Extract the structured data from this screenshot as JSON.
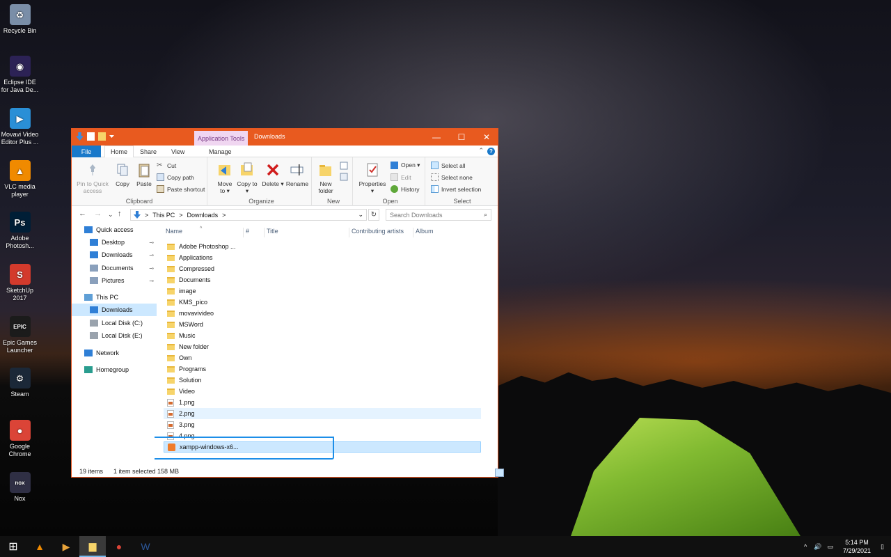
{
  "desktop": {
    "icons": [
      {
        "label": "Recycle Bin",
        "icon": "recycle-bin-icon",
        "color": "#7a8ea8"
      },
      {
        "label": "Eclipse IDE for Java De...",
        "icon": "eclipse-icon",
        "color": "#2c2255"
      },
      {
        "label": "Movavi Video Editor Plus ...",
        "icon": "movavi-icon",
        "color": "#2a8fd6"
      },
      {
        "label": "VLC media player",
        "icon": "vlc-icon",
        "color": "#f08a00"
      },
      {
        "label": "Adobe Photosh...",
        "icon": "photoshop-icon",
        "color": "#001e36"
      },
      {
        "label": "SketchUp 2017",
        "icon": "sketchup-icon",
        "color": "#d33a2c"
      },
      {
        "label": "Epic Games Launcher",
        "icon": "epic-games-icon",
        "color": "#1b1b1b"
      },
      {
        "label": "Steam",
        "icon": "steam-icon",
        "color": "#1b2838"
      },
      {
        "label": "Google Chrome",
        "icon": "chrome-icon",
        "color": "#db4437"
      },
      {
        "label": "Nox",
        "icon": "nox-icon",
        "color": "#2f2f44"
      }
    ],
    "icon_glyphs": [
      "♻",
      "◉",
      "▶",
      "▲",
      "Ps",
      "S",
      "EPIC",
      "⚙",
      "●",
      "nox"
    ]
  },
  "window": {
    "context_tab": "Application Tools",
    "title": "Downloads",
    "controls": {
      "minimize": "—",
      "maximize": "☐",
      "close": "✕"
    },
    "tabs": [
      "File",
      "Home",
      "Share",
      "View",
      "Manage"
    ],
    "help": "?",
    "chevron": "⌃",
    "ribbon": {
      "clipboard": {
        "label": "Clipboard",
        "pin": "Pin to Quick access",
        "copy": "Copy",
        "paste": "Paste",
        "cut": "Cut",
        "copy_path": "Copy path",
        "paste_shortcut": "Paste shortcut"
      },
      "organize": {
        "label": "Organize",
        "move_to": "Move to ▾",
        "copy_to": "Copy to ▾",
        "delete": "Delete ▾",
        "rename": "Rename"
      },
      "new": {
        "label": "New",
        "new_folder": "New folder"
      },
      "open": {
        "label": "Open",
        "properties": "Properties ▾",
        "open": "Open ▾",
        "edit": "Edit",
        "history": "History"
      },
      "select": {
        "label": "Select",
        "select_all": "Select all",
        "select_none": "Select none",
        "invert": "Invert selection"
      }
    },
    "address": {
      "path": [
        "This PC",
        "Downloads"
      ],
      "separator": ">",
      "dropdown": "⌄",
      "refresh": "↻",
      "back": "←",
      "forward": "→",
      "recent": "⌄",
      "up": "↑"
    },
    "search": {
      "placeholder": "Search Downloads",
      "icon": "⌕"
    },
    "nav": [
      {
        "label": "Quick access",
        "icon": "star-icon",
        "indent": 0
      },
      {
        "label": "Desktop",
        "icon": "desktop-icon",
        "indent": 1,
        "pinned": true
      },
      {
        "label": "Downloads",
        "icon": "download-icon",
        "indent": 1,
        "pinned": true
      },
      {
        "label": "Documents",
        "icon": "document-icon",
        "indent": 1,
        "pinned": true
      },
      {
        "label": "Pictures",
        "icon": "pictures-icon",
        "indent": 1,
        "pinned": true
      },
      {
        "label": "This PC",
        "icon": "computer-icon",
        "indent": 0
      },
      {
        "label": "Downloads",
        "icon": "download-icon",
        "indent": 1,
        "selected": true
      },
      {
        "label": "Local Disk (C:)",
        "icon": "drive-icon",
        "indent": 1
      },
      {
        "label": "Local Disk (E:)",
        "icon": "drive-icon",
        "indent": 1
      },
      {
        "label": "Network",
        "icon": "network-icon",
        "indent": 0
      },
      {
        "label": "Homegroup",
        "icon": "homegroup-icon",
        "indent": 0
      }
    ],
    "columns": [
      "Name",
      "#",
      "Title",
      "Contributing artists",
      "Album"
    ],
    "sort_caret": "^",
    "files": [
      {
        "name": "Adobe Photoshop ...",
        "type": "folder"
      },
      {
        "name": "Applications",
        "type": "folder"
      },
      {
        "name": "Compressed",
        "type": "folder"
      },
      {
        "name": "Documents",
        "type": "folder"
      },
      {
        "name": "image",
        "type": "folder"
      },
      {
        "name": "KMS_pico",
        "type": "folder"
      },
      {
        "name": "movavivideo",
        "type": "folder"
      },
      {
        "name": "MSWord",
        "type": "folder"
      },
      {
        "name": "Music",
        "type": "folder"
      },
      {
        "name": "New folder",
        "type": "folder"
      },
      {
        "name": "Own",
        "type": "folder"
      },
      {
        "name": "Programs",
        "type": "folder"
      },
      {
        "name": "Solution",
        "type": "folder"
      },
      {
        "name": "Video",
        "type": "folder"
      },
      {
        "name": "1.png",
        "type": "png"
      },
      {
        "name": "2.png",
        "type": "png",
        "hover": true
      },
      {
        "name": "3.png",
        "type": "png"
      },
      {
        "name": "4.png",
        "type": "png"
      },
      {
        "name": "xampp-windows-x6...",
        "type": "exe",
        "selected": true
      }
    ],
    "status": {
      "count": "19 items",
      "selection": "1 item selected  158 MB"
    }
  },
  "taskbar": {
    "start_glyph": "⊞",
    "apps": [
      {
        "name": "vlc",
        "glyph": "▲",
        "color": "#f08a00"
      },
      {
        "name": "movavi",
        "glyph": "▶",
        "color": "#e8a33a"
      },
      {
        "name": "file-explorer",
        "glyph": "▆",
        "color": "#f7d46a",
        "active": true
      },
      {
        "name": "chrome",
        "glyph": "●",
        "color": "#db4437"
      },
      {
        "name": "word",
        "glyph": "W",
        "color": "#2b579a"
      }
    ],
    "tray": {
      "chevron": "^",
      "volume": "🔊",
      "network": "▭",
      "time": "5:14 PM",
      "date": "7/29/2021",
      "notify": "▯"
    }
  },
  "colors": {
    "titlebar": "#e85a1f",
    "accent": "#1979ca",
    "selection": "#cce8ff",
    "annotation": "#1c8ee8"
  }
}
